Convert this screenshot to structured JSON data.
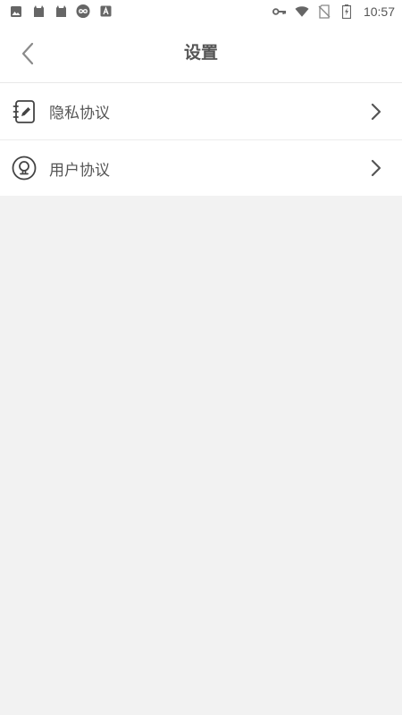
{
  "status_bar": {
    "time": "10:57",
    "left_icons": [
      "image-icon",
      "cat-icon",
      "cat-icon",
      "infinity-icon",
      "font-icon"
    ],
    "right_icons": [
      "key-icon",
      "wifi-icon",
      "no-sim-icon",
      "battery-charging-icon"
    ]
  },
  "header": {
    "title": "设置",
    "back_icon": "chevron-left-icon"
  },
  "settings": {
    "items": [
      {
        "label": "隐私协议",
        "icon": "notebook-pen-icon"
      },
      {
        "label": "用户协议",
        "icon": "user-circle-icon"
      }
    ]
  },
  "colors": {
    "background": "#f2f2f2",
    "surface": "#ffffff",
    "text": "#555555",
    "divider": "#ececec"
  }
}
